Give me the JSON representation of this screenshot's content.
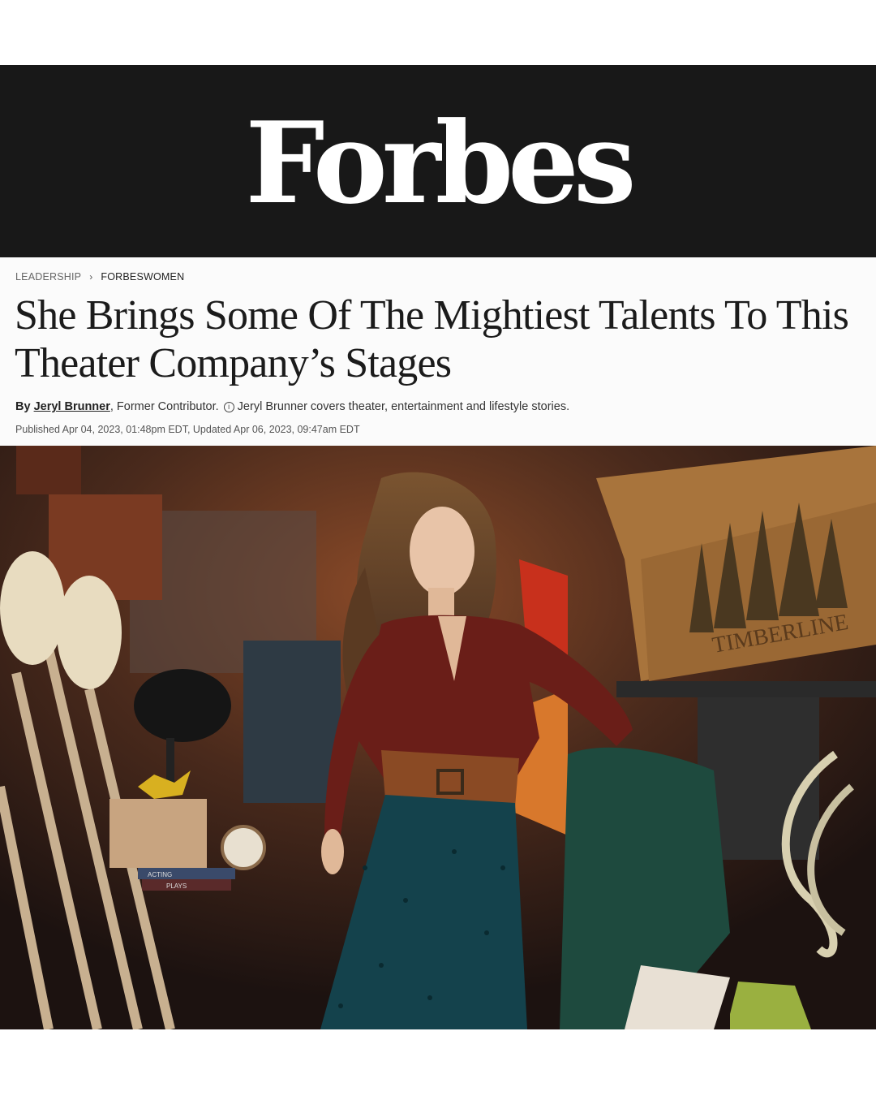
{
  "masthead": {
    "logo_text": "Forbes",
    "background": "#181818"
  },
  "breadcrumb": {
    "section": "LEADERSHIP",
    "subsection": "FORBESWOMEN"
  },
  "headline": "She Brings Some Of The Mightiest Talents To This Theater Company’s Stages",
  "byline": {
    "by": "By",
    "author": "Jeryl Brunner",
    "role": ", Former Contributor.",
    "description": "Jeryl Brunner covers theater, entertainment and lifestyle stories."
  },
  "published": "Published Apr 04, 2023, 01:48pm EDT, Updated Apr 06, 2023, 09:47am EDT",
  "photo": {
    "box_text": "TIMBERLINE",
    "book_text_1": "ACTING",
    "book_text_2": "PLAYS"
  }
}
